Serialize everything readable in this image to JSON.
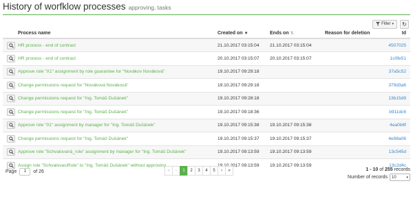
{
  "header": {
    "title": "History of worfklow processes",
    "subtitle": "approving, tasks"
  },
  "toolbar": {
    "filter_label": "Filter",
    "filter_icon": "funnel-icon",
    "refresh_icon": "refresh-icon"
  },
  "table": {
    "columns": {
      "name": "Process name",
      "created": "Created on",
      "ends": "Ends on",
      "reason": "Reason for deletion",
      "id": "Id"
    },
    "rows": [
      {
        "name": "HR process - end of contract",
        "created": "21.10.2017 03:15:04",
        "ends": "21.10.2017 03:15:04",
        "reason": "",
        "id": "4507025"
      },
      {
        "name": "HR process - end of contract",
        "created": "20.10.2017 03:15:07",
        "ends": "20.10.2017 03:15:07",
        "reason": "",
        "id": "1c0fe51"
      },
      {
        "name": "Approve role \"X1\" assignment by role guarantee for \"Novákov Nováková\"",
        "created": "19.10.2017 09:29:18",
        "ends": "",
        "reason": "",
        "id": "37a5c52"
      },
      {
        "name": "Change permissions request for \"Nováková Nováková\"",
        "created": "19.10.2017 09:29:18",
        "ends": "",
        "reason": "",
        "id": "379d3a6"
      },
      {
        "name": "Change permissions request for \"Ing. Tomáš Dušánek\"",
        "created": "19.10.2017 09:28:18",
        "ends": "",
        "reason": "",
        "id": "13b15d9"
      },
      {
        "name": "Change permissions request for \"Ing. Tomáš Dušánek\"",
        "created": "19.10.2017 09:18:36",
        "ends": "",
        "reason": "",
        "id": "b911dc6"
      },
      {
        "name": "Approve role \"01\" assignment by manager for \"Ing. Tomáš Dušánek\"",
        "created": "19.10.2017 09:15:38",
        "ends": "19.10.2017 09:15:38",
        "reason": "",
        "id": "4ea0b6f"
      },
      {
        "name": "Change permissions request for \"Ing. Tomáš Dušánek\"",
        "created": "19.10.2017 09:15:37",
        "ends": "19.10.2017 09:15:37",
        "reason": "",
        "id": "4e98a06"
      },
      {
        "name": "Approve role \"Schvalovaná_role\" assignment by manager for \"Ing. Tomáš Dušánek\"",
        "created": "19.10.2017 09:13:59",
        "ends": "19.10.2017 09:13:59",
        "reason": "",
        "id": "13c545d"
      },
      {
        "name": "Assign role \"SchvalovaciRole\" to \"Ing. Tomáš Dušánek\" without approving",
        "created": "19.10.2017 09:13:59",
        "ends": "19.10.2017 09:13:59",
        "reason": "",
        "id": "13c2d4c"
      }
    ]
  },
  "footer": {
    "page_label": "Page",
    "page_value": "1",
    "of_label": "of 26",
    "pager": [
      "«",
      "‹",
      "1",
      "2",
      "3",
      "4",
      "5",
      "›",
      "»"
    ],
    "records_range": "1 - 10",
    "records_of": "of",
    "records_total": "255",
    "records_word": "records",
    "records_per_page_label": "Number of records",
    "records_per_page_value": "10"
  }
}
